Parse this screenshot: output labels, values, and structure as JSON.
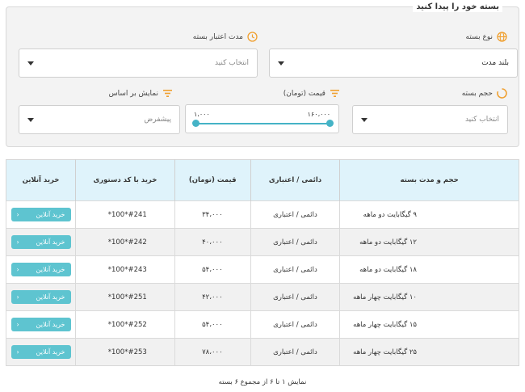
{
  "filter": {
    "title": "بسته خود را پیدا کنید",
    "package_type": {
      "label": "نوع بسته",
      "value": "بلند مدت"
    },
    "validity": {
      "label": "مدت اعتبار بسته",
      "placeholder": "انتخاب کنید"
    },
    "volume": {
      "label": "حجم بسته",
      "placeholder": "انتخاب کنید"
    },
    "price": {
      "label": "قیمت (تومان)",
      "min": "۱،۰۰۰",
      "max": "۱۶۰،۰۰۰"
    },
    "sort": {
      "label": "نمایش بر اساس",
      "value": "پیشفرض"
    }
  },
  "table": {
    "headers": [
      "حجم و مدت بسته",
      "دائمی / اعتباری",
      "قیمت (تومان)",
      "خرید با کد دستوری",
      "خرید آنلاین"
    ],
    "rows": [
      {
        "name": "۹ گیگابایت دو ماهه",
        "type": "دائمی / اعتباری",
        "price": "۳۴،۰۰۰",
        "code": "#241*100*",
        "buy": "خرید آنلاین"
      },
      {
        "name": "۱۲ گیگابایت دو ماهه",
        "type": "دائمی / اعتباری",
        "price": "۴۰،۰۰۰",
        "code": "#242*100*",
        "buy": "خرید آنلاین"
      },
      {
        "name": "۱۸ گیگابایت دو ماهه",
        "type": "دائمی / اعتباری",
        "price": "۵۴،۰۰۰",
        "code": "#243*100*",
        "buy": "خرید آنلاین"
      },
      {
        "name": "۱۰ گیگابایت چهار ماهه",
        "type": "دائمی / اعتباری",
        "price": "۴۲،۰۰۰",
        "code": "#251*100*",
        "buy": "خرید آنلاین"
      },
      {
        "name": "۱۵ گیگابایت چهار ماهه",
        "type": "دائمی / اعتباری",
        "price": "۵۴،۰۰۰",
        "code": "#252*100*",
        "buy": "خرید آنلاین"
      },
      {
        "name": "۲۵ گیگابایت چهار ماهه",
        "type": "دائمی / اعتباری",
        "price": "۷۸،۰۰۰",
        "code": "#253*100*",
        "buy": "خرید آنلاین"
      }
    ]
  },
  "summary": "نمایش ۱ تا ۶ از مجموع ۶ بسته",
  "icons": {
    "package_type": "globe-icon",
    "validity": "clock-icon",
    "volume": "spinner-icon",
    "price": "sort-lines-icon",
    "sort": "sort-lines-icon",
    "buy_arrow": "chevron-left-icon"
  },
  "colors": {
    "accent": "#f0a030",
    "teal": "#45b3c6",
    "button": "#5ec4d0",
    "header_bg": "#dff3fb"
  }
}
